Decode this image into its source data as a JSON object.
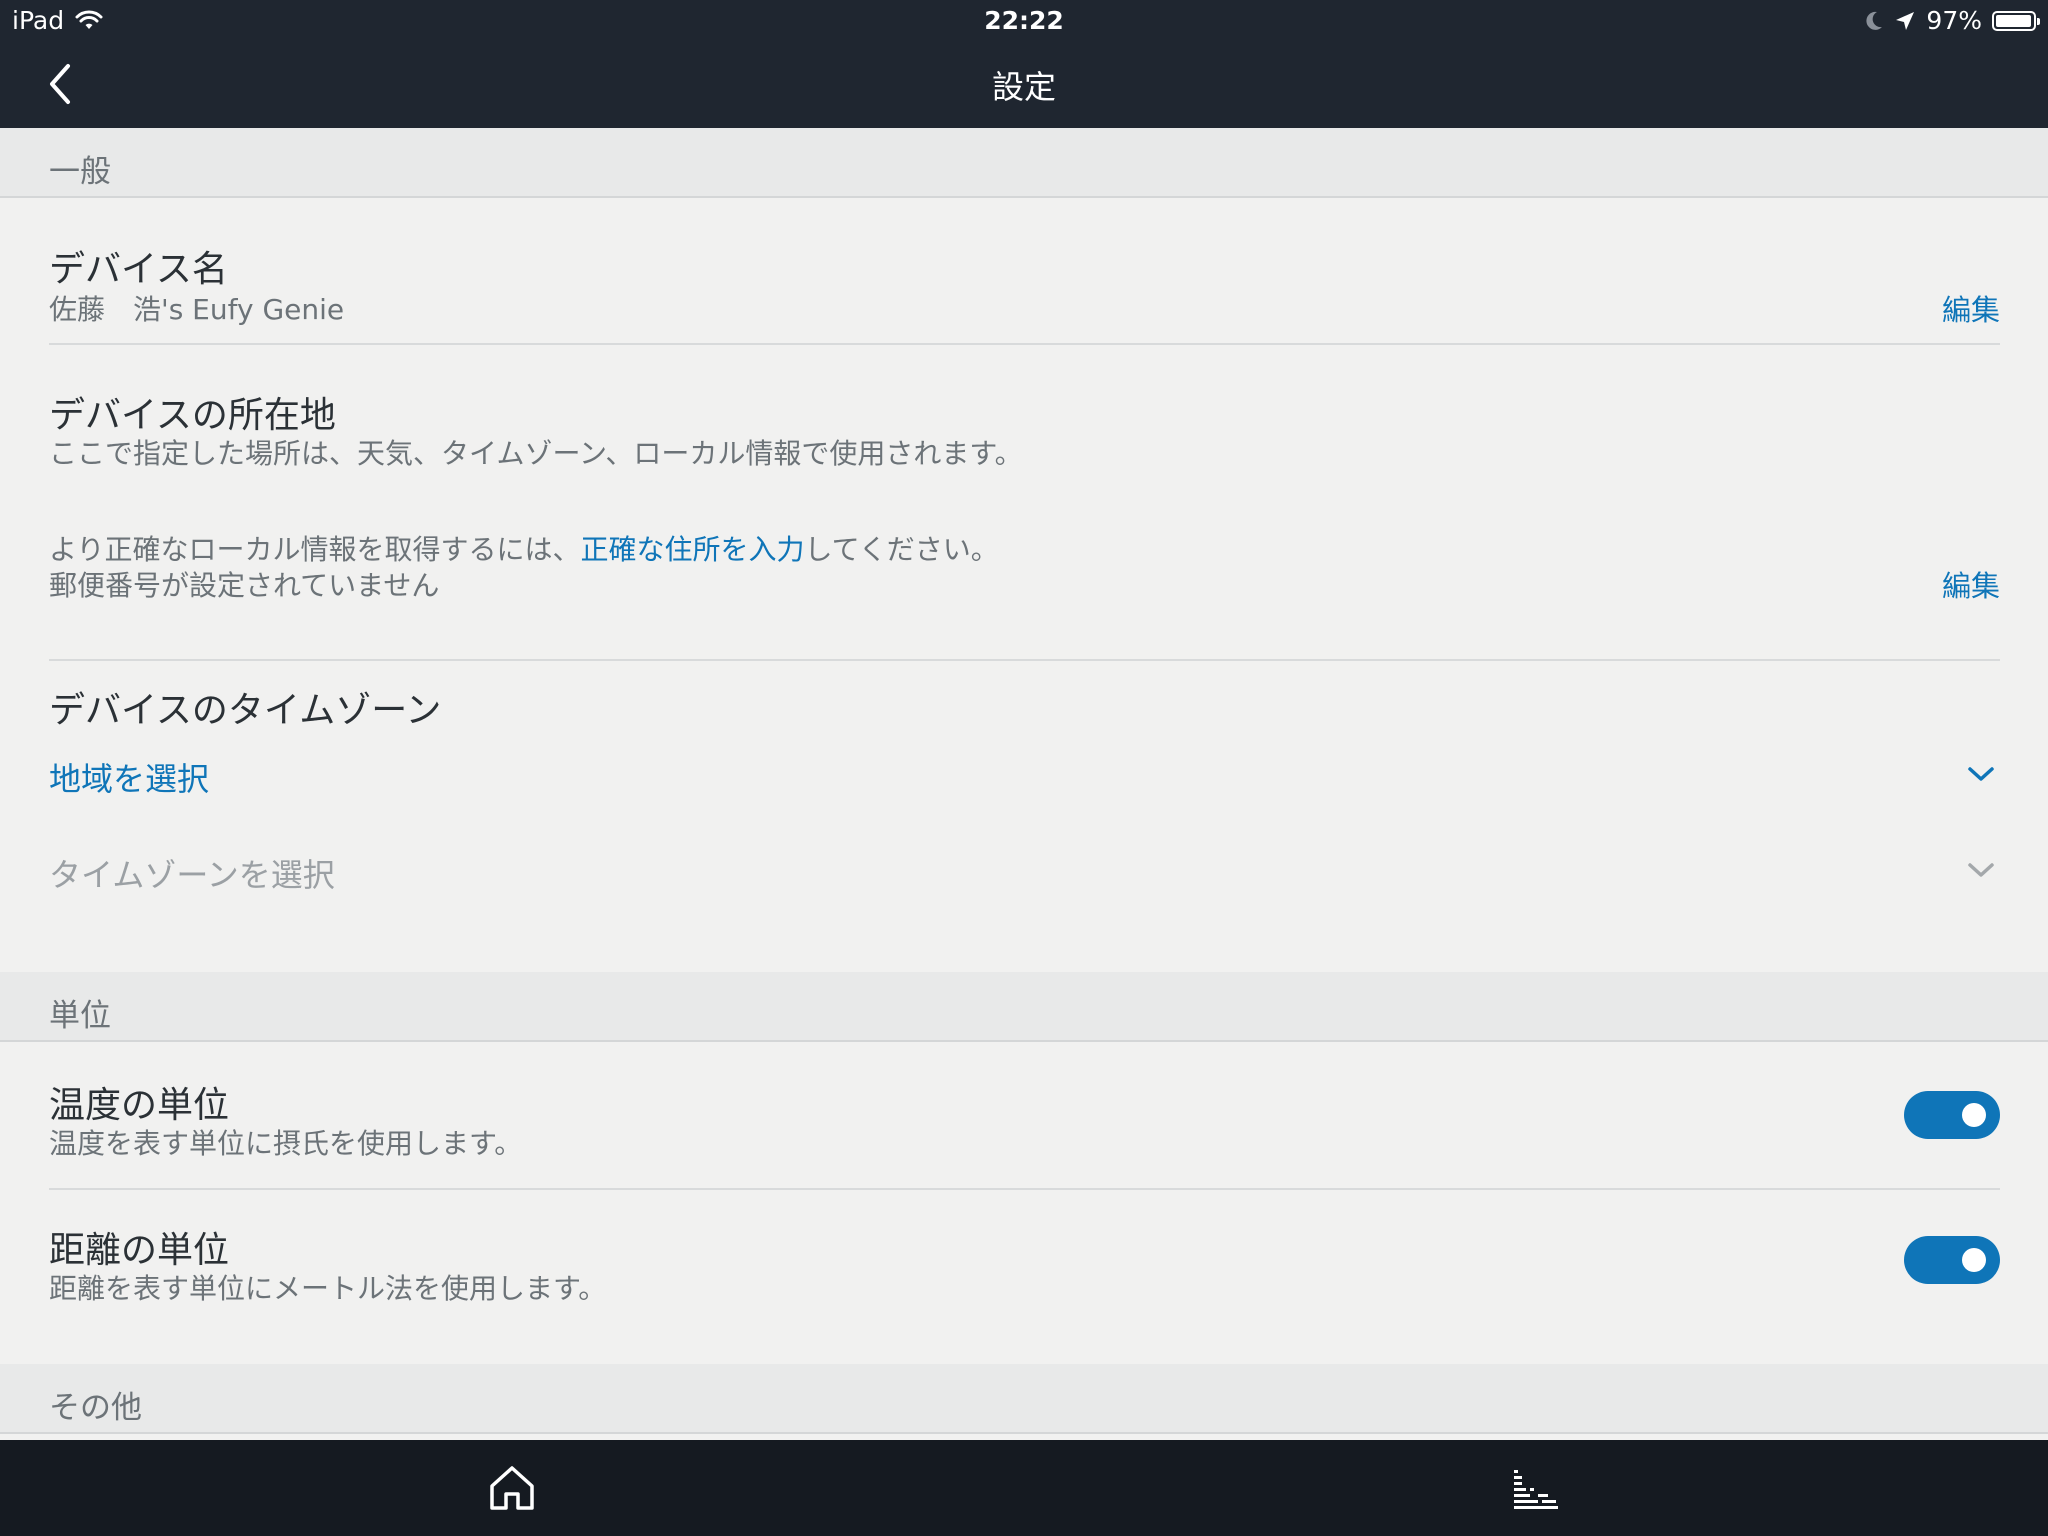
{
  "status_bar": {
    "device": "iPad",
    "time": "22:22",
    "battery": "97%",
    "battery_level": 0.97,
    "icons": [
      "wifi-icon",
      "moon-icon",
      "location-arrow-icon",
      "battery-icon"
    ]
  },
  "nav": {
    "title": "設定",
    "back_icon": "chevron-left-icon"
  },
  "sections": {
    "general": "一般",
    "units": "単位",
    "other": "その他"
  },
  "device_name": {
    "title": "デバイス名",
    "value": "佐藤　浩's Eufy Genie",
    "edit": "編集"
  },
  "device_location": {
    "title": "デバイスの所在地",
    "description": "ここで指定した場所は、天気、タイムゾーン、ローカル情報で使用されます。",
    "hint_prefix": "より正確なローカル情報を取得するには、",
    "hint_link": "正確な住所を入力",
    "hint_suffix": "してください。",
    "postal_status": "郵便番号が設定されていません",
    "edit": "編集"
  },
  "time_zone": {
    "title": "デバイスのタイムゾーン",
    "region_select": "地域を選択",
    "timezone_select": "タイムゾーンを選択"
  },
  "temperature_unit": {
    "title": "温度の単位",
    "description": "温度を表す単位に摂氏を使用します。",
    "enabled": true
  },
  "distance_unit": {
    "title": "距離の単位",
    "description": "距離を表す単位にメートル法を使用します。",
    "enabled": true
  },
  "tab_bar": {
    "items": [
      "home-icon",
      "activity-icon"
    ]
  },
  "colors": {
    "header_bg": "#1f2630",
    "tab_bar_bg": "#151a21",
    "accent": "#0f75b8",
    "page_bg": "#f1f1f0",
    "section_bg": "#e8e9e9"
  }
}
